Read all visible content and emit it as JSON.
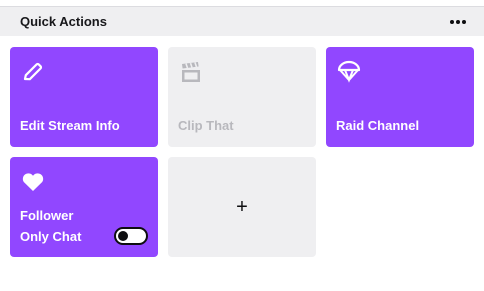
{
  "header": {
    "title": "Quick Actions"
  },
  "tiles": [
    {
      "label": "Edit Stream Info",
      "icon": "pencil-icon",
      "enabled": true
    },
    {
      "label": "Clip That",
      "icon": "clapperboard-icon",
      "enabled": false
    },
    {
      "label": "Raid Channel",
      "icon": "parachute-icon",
      "enabled": true
    },
    {
      "label_line1": "Follower",
      "label_line2": "Only Chat",
      "icon": "heart-icon",
      "enabled": true,
      "toggle_on": false
    },
    {
      "label": "+",
      "icon": "plus-icon"
    }
  ],
  "colors": {
    "accent": "#9147ff",
    "disabled_bg": "#efeff1",
    "disabled_text": "#b8b8bd"
  }
}
